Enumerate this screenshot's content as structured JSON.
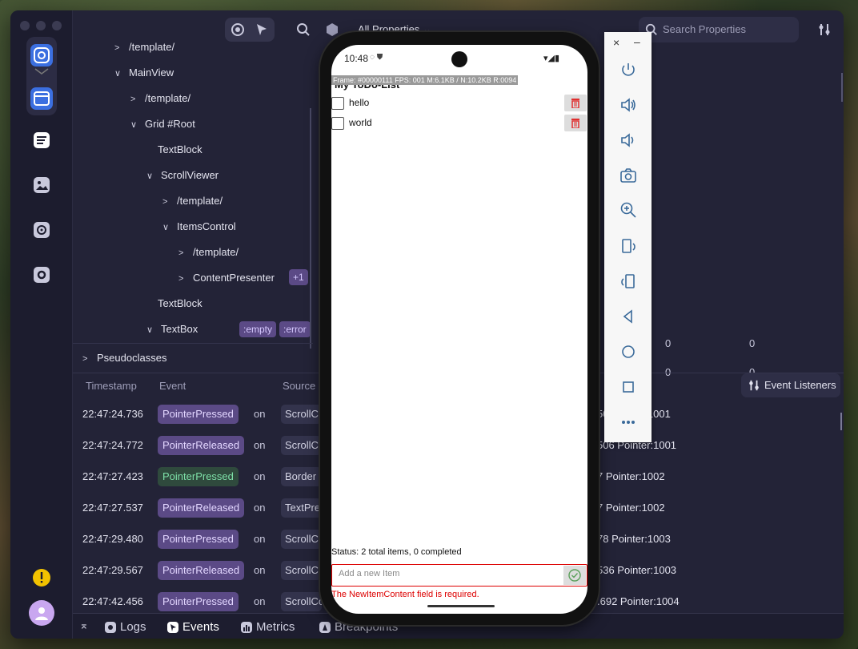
{
  "tree": {
    "rows": [
      {
        "label": "/template/",
        "chevron": "v"
      },
      {
        "label": "MainView",
        "chevron": "v"
      },
      {
        "label": "/template/",
        "chevron": ">"
      },
      {
        "label": "Grid #Root",
        "chevron": "v"
      },
      {
        "label": "TextBlock",
        "chevron": ""
      },
      {
        "label": "ScrollViewer",
        "chevron": "v"
      },
      {
        "label": "/template/",
        "chevron": ">"
      },
      {
        "label": "ItemsControl",
        "chevron": "v"
      },
      {
        "label": "/template/",
        "chevron": ">"
      },
      {
        "label": "ContentPresenter",
        "chevron": ">"
      },
      {
        "label": "TextBlock",
        "chevron": ""
      },
      {
        "label": "TextBox",
        "chevron": "v"
      }
    ],
    "badge_plus": "+1",
    "badge_empty": ":empty",
    "badge_error": ":error",
    "pseudoclasses": "Pseudoclasses"
  },
  "toolbar": {
    "all_properties": "All Properties",
    "search_placeholder": "Search Properties"
  },
  "layout_values": {
    "a": "0",
    "b": "0",
    "c": "0",
    "d": "0"
  },
  "events": {
    "headers": {
      "timestamp": "Timestamp",
      "event": "Event",
      "source": "Source"
    },
    "event_listeners": "Event Listeners",
    "rows": [
      {
        "ts": "22:47:24.736",
        "event": "PointerPressed",
        "style": "purple",
        "on": "on",
        "source": "ScrollCo",
        "right": "50 Pointer:1001"
      },
      {
        "ts": "22:47:24.772",
        "event": "PointerReleased",
        "style": "purple",
        "on": "on",
        "source": "ScrollCo",
        "right": "506 Pointer:1001"
      },
      {
        "ts": "22:47:27.423",
        "event": "PointerPressed",
        "style": "green",
        "on": "on",
        "source": "Border",
        "right": "7 Pointer:1002"
      },
      {
        "ts": "22:47:27.537",
        "event": "PointerReleased",
        "style": "purple",
        "on": "on",
        "source": "TextPre",
        "right": "7 Pointer:1002"
      },
      {
        "ts": "22:47:29.480",
        "event": "PointerPressed",
        "style": "purple",
        "on": "on",
        "source": "ScrollCo",
        "right": "78 Pointer:1003"
      },
      {
        "ts": "22:47:29.567",
        "event": "PointerReleased",
        "style": "purple",
        "on": "on",
        "source": "ScrollCo",
        "right": "536 Pointer:1003"
      },
      {
        "ts": "22:47:42.456",
        "event": "PointerPressed",
        "style": "purple",
        "on": "on",
        "source": "ScrollCo",
        "right": ".692 Pointer:1004"
      }
    ]
  },
  "bottom_tabs": {
    "logs": "Logs",
    "events": "Events",
    "metrics": "Metrics",
    "breakpoints": "Breakpoints"
  },
  "phone": {
    "time": "10:48",
    "frame_stats": "Frame: #00000111 FPS: 001 M:6.1KB / N:10.2KB R:0094",
    "app_title": "My ToDo-List",
    "items": [
      {
        "label": "hello"
      },
      {
        "label": "world"
      }
    ],
    "status": "Status: 2 total items, 0 completed",
    "new_item_placeholder": "Add a new Item",
    "error": "The NewItemContent field is required."
  },
  "emulator": {
    "close": "×",
    "minimize": "–"
  },
  "colors": {
    "accent_purple": "#5b4a86",
    "green_event": "#7ee0a8",
    "error_red": "#dd0000"
  }
}
